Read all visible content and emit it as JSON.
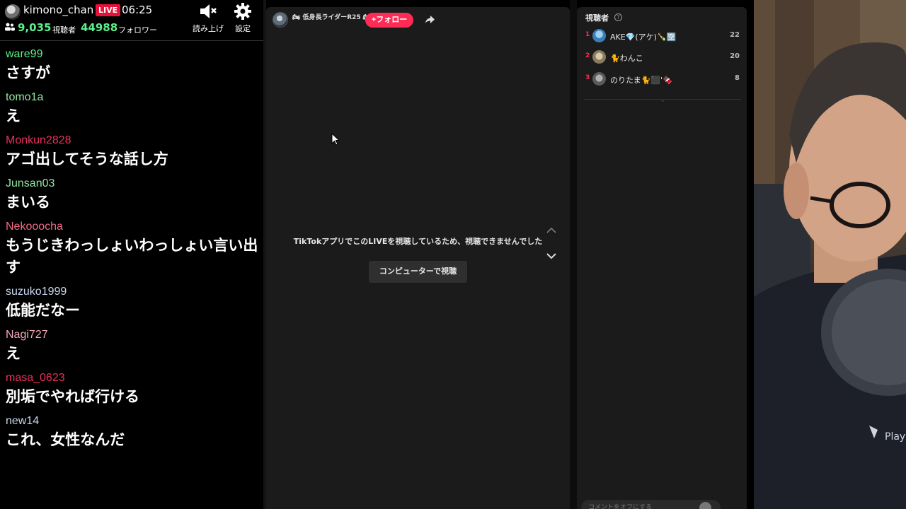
{
  "header": {
    "streamer_name": "kimono_chan",
    "live_badge": "LIVE",
    "elapsed_time": "06:25",
    "viewer_count": "9,035",
    "viewer_label": "視聴者",
    "follower_count": "44988",
    "follower_label": "フォロワー",
    "tts_label": "読み上げ",
    "settings_label": "設定"
  },
  "comments": [
    {
      "user": "ware99",
      "text": "さすが",
      "color": "#5cf08c"
    },
    {
      "user": "tomo1a",
      "text": "え",
      "color": "#8fe6a0"
    },
    {
      "user": "Monkun2828",
      "text": "アゴ出してそうな話し方",
      "color": "#e8305b"
    },
    {
      "user": "Junsan03",
      "text": "まいる",
      "color": "#8fe6a0"
    },
    {
      "user": "Nekooocha",
      "text": "もうじきわっしょいわっしょい言い出す",
      "color": "#f06a8a"
    },
    {
      "user": "suzuko1999",
      "text": "低能だなー",
      "color": "#c9d8f0"
    },
    {
      "user": "Nagi727",
      "text": "え",
      "color": "#f2a8b8"
    },
    {
      "user": "masa_0623",
      "text": "別垢でやれば行ける",
      "color": "#e8305b"
    },
    {
      "user": "new14",
      "text": "これ、女性なんだ",
      "color": "#c9d8f0"
    }
  ],
  "live_room": {
    "host_name": "🏍 低身長ライダーR25 🏍",
    "follow_label": "+フォロー",
    "notice_text": "TikTokアプリでこのLIVEを視聴しているため、視聴できませんでした",
    "watch_button_label": "コンピューターで視聴"
  },
  "ranking": {
    "title": "視聴者",
    "rows": [
      {
        "rank": "1",
        "name": "AKE💎(アケ)🍾🈳",
        "score": "22"
      },
      {
        "rank": "2",
        "name": "🐈わんこ",
        "score": "20"
      },
      {
        "rank": "3",
        "name": "のりたま🐈⬛'🍫",
        "score": "8"
      }
    ],
    "comment_placeholder": "コメントをオフにする"
  },
  "colors": {
    "accent": "#fe2c55",
    "count_green": "#5cf08c",
    "panel_bg": "#1b1b1b"
  }
}
